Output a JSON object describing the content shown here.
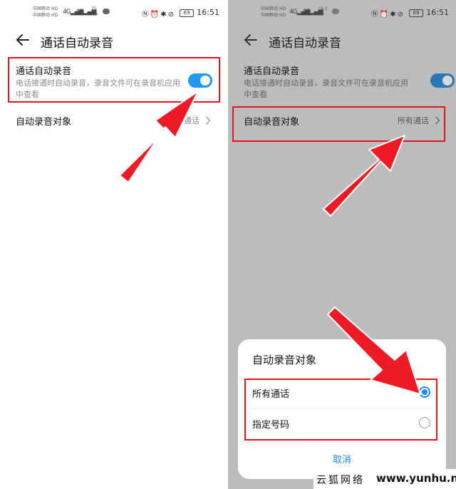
{
  "colors": {
    "accent": "#2196f3",
    "highlight": "#e3141b",
    "dim": "#bcbcbc"
  },
  "left": {
    "status": {
      "carrier1": "中国移动",
      "carrier2": "中国移动",
      "hd": "HD",
      "speed_value": "35",
      "speed_unit": "B/s",
      "signal1": "4G",
      "signal2": "4G",
      "battery": "69",
      "time": "16:51"
    },
    "title": "通话自动录音",
    "auto_record": {
      "title": "通话自动录音",
      "description": "电话接通时自动录音，录音文件可在录音机应用中查看",
      "enabled": true
    },
    "target": {
      "label": "自动录音对象",
      "value": "所有通话"
    }
  },
  "right": {
    "status": {
      "carrier1": "中国移动",
      "carrier2": "中国移动",
      "hd": "HD",
      "speed_value": "19.3",
      "speed_unit": "K/s",
      "signal1": "4G",
      "signal2": "4G",
      "battery": "69",
      "time": "16:51"
    },
    "title": "通话自动录音",
    "auto_record": {
      "title": "通话自动录音",
      "description": "电话接通时自动录音，录音文件可在录音机应用中查看",
      "enabled": true
    },
    "target": {
      "label": "自动录音对象",
      "value": "所有通话"
    },
    "dialog": {
      "title": "自动录音对象",
      "options": [
        {
          "label": "所有通话",
          "selected": true
        },
        {
          "label": "指定号码",
          "selected": false
        }
      ],
      "cancel": "取消"
    }
  },
  "watermark": {
    "brand": "云狐网络",
    "url": "www.yunhu.net"
  },
  "icons": [
    "back-arrow-icon",
    "chevron-right-icon",
    "message-icon",
    "nfc-icon",
    "alarm-icon",
    "bluetooth-icon",
    "mute-icon",
    "battery-icon"
  ]
}
